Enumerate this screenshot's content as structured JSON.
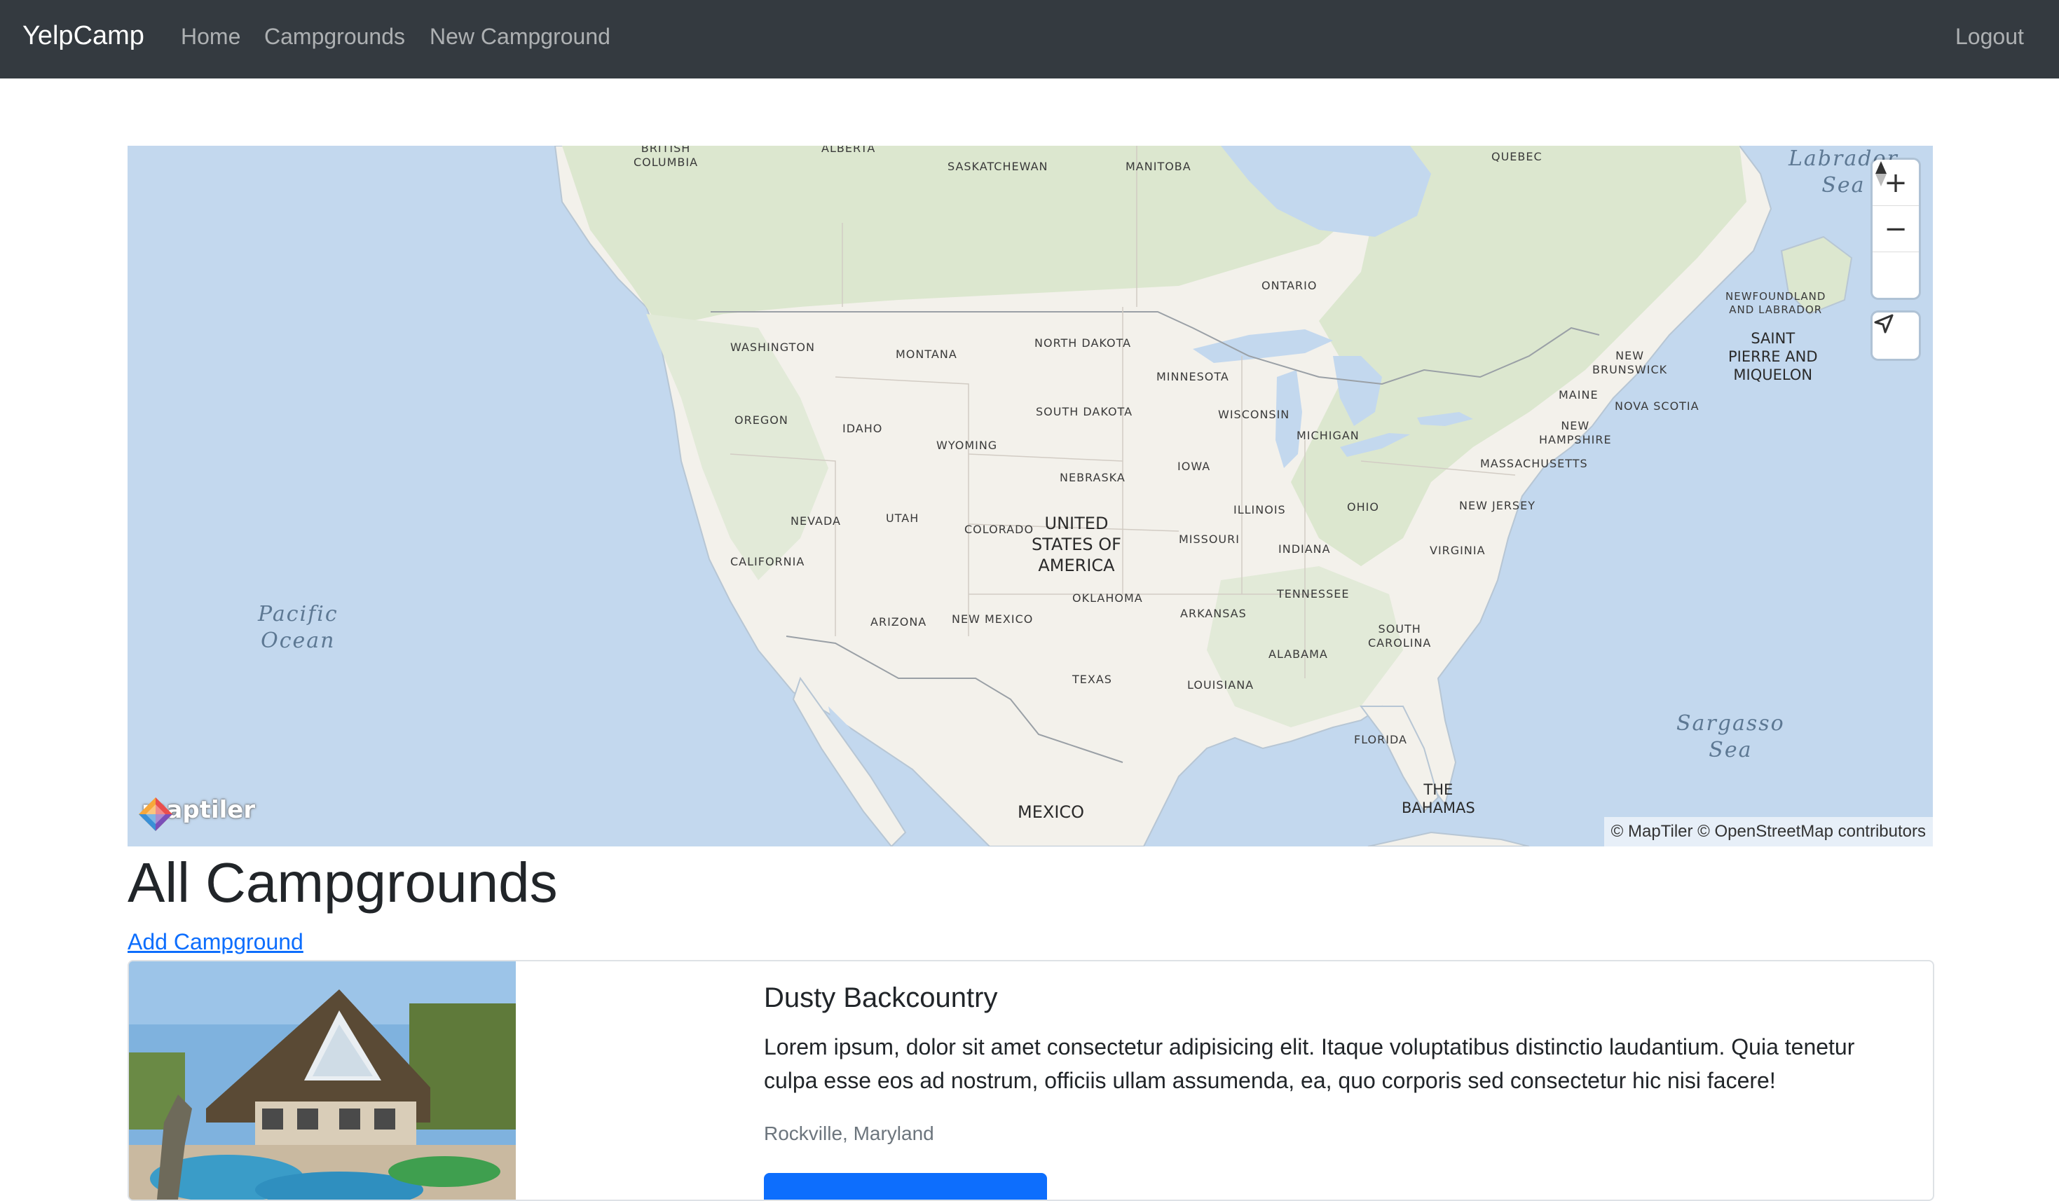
{
  "navbar": {
    "brand": "YelpCamp",
    "links": [
      "Home",
      "Campgrounds",
      "New Campground"
    ],
    "logout": "Logout"
  },
  "map": {
    "zoom_in": "+",
    "zoom_out": "−",
    "logo_text": "maptiler",
    "attribution": "© MapTiler © OpenStreetMap contributors",
    "oceans": {
      "pacific": "Pacific\nOcean",
      "labrador": "Labrador\nSea",
      "sargasso": "Sargasso\nSea"
    },
    "countries": {
      "usa": "UNITED\nSTATES OF\nAMERICA",
      "mexico": "MEXICO",
      "spm": "SAINT\nPIERRE AND\nMIQUELON",
      "bahamas": "THE\nBAHAMAS"
    },
    "regions": {
      "british_columbia": "BRITISH\nCOLUMBIA",
      "alberta": "ALBERTA",
      "saskatchewan": "SASKATCHEWAN",
      "manitoba": "MANITOBA",
      "quebec": "QUEBEC",
      "ontario": "ONTARIO",
      "newfoundland": "NEWFOUNDLAND\nAND LABRADOR",
      "new_brunswick": "NEW\nBRUNSWICK",
      "nova_scotia": "NOVA SCOTIA",
      "washington": "WASHINGTON",
      "montana": "MONTANA",
      "north_dakota": "NORTH DAKOTA",
      "minnesota": "MINNESOTA",
      "maine": "MAINE",
      "oregon": "OREGON",
      "idaho": "IDAHO",
      "south_dakota": "SOUTH DAKOTA",
      "wisconsin": "WISCONSIN",
      "michigan": "MICHIGAN",
      "new_hampshire": "NEW\nHAMPSHIRE",
      "wyoming": "WYOMING",
      "massachusetts": "MASSACHUSETTS",
      "nebraska": "NEBRASKA",
      "iowa": "IOWA",
      "nevada": "NEVADA",
      "utah": "UTAH",
      "colorado": "COLORADO",
      "illinois": "ILLINOIS",
      "ohio": "OHIO",
      "new_jersey": "NEW JERSEY",
      "missouri": "MISSOURI",
      "indiana": "INDIANA",
      "virginia": "VIRGINIA",
      "california": "CALIFORNIA",
      "tennessee": "TENNESSEE",
      "oklahoma": "OKLAHOMA",
      "arizona": "ARIZONA",
      "new_mexico": "NEW MEXICO",
      "arkansas": "ARKANSAS",
      "south_carolina": "SOUTH\nCAROLINA",
      "alabama": "ALABAMA",
      "texas": "TEXAS",
      "louisiana": "LOUISIANA",
      "florida": "FLORIDA"
    }
  },
  "page": {
    "heading": "All Campgrounds",
    "add_link": "Add Campground"
  },
  "campgrounds": [
    {
      "title": "Dusty Backcountry",
      "description": "Lorem ipsum, dolor sit amet consectetur adipisicing elit. Itaque voluptatibus distinctio laudantium. Quia tenetur culpa esse eos ad nostrum, officiis ullam assumenda, ea, quo corporis sed consectetur hic nisi facere!",
      "location": "Rockville, Maryland"
    }
  ],
  "colors": {
    "navbar_bg": "#343a40",
    "link": "#0d6efd",
    "water": "#c3d8ee",
    "land": "#f3f1eb",
    "forest": "#dce7cf"
  }
}
